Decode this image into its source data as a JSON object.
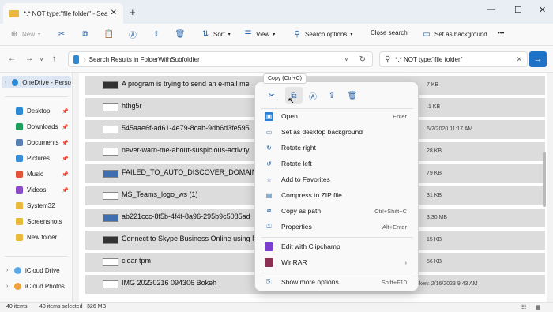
{
  "window": {
    "tab_title": "*.* NOT type:\"file folder\" - Sea",
    "new_tab_symbol": "+",
    "close_tab_symbol": "✕",
    "minimize": "—",
    "maximize": "☐",
    "close": "✕"
  },
  "toolbar": {
    "new_label": "New",
    "sort_label": "Sort",
    "view_label": "View",
    "search_options_label": "Search options",
    "close_search_label": "Close search",
    "set_background_label": "Set as background",
    "more_symbol": "•••"
  },
  "address": {
    "path": "Search Results in FolderWithSubfoldfer",
    "search_query": "*.* NOT type:\"file folder\""
  },
  "sidebar": {
    "onedrive": "OneDrive - Perso",
    "items": [
      {
        "label": "Desktop",
        "color": "#2b8ad6"
      },
      {
        "label": "Downloads",
        "color": "#1e9e5a"
      },
      {
        "label": "Documents",
        "color": "#5a7fb3"
      },
      {
        "label": "Pictures",
        "color": "#3a8ed8"
      },
      {
        "label": "Music",
        "color": "#e0553a"
      },
      {
        "label": "Videos",
        "color": "#8b4bc9"
      },
      {
        "label": "System32",
        "color": "#e8b93a"
      },
      {
        "label": "Screenshots",
        "color": "#e8b93a"
      },
      {
        "label": "New folder",
        "color": "#e8b93a"
      }
    ],
    "icloud_drive": "iCloud Drive",
    "icloud_photos": "iCloud Photos"
  },
  "files": [
    {
      "name": "A program is trying to send an e-mail me",
      "meta": "7 KB"
    },
    {
      "name": "hthg5r",
      "meta": ".1 KB"
    },
    {
      "name": "545aae6f-ad61-4e79-8cab-9db6d3fe595",
      "meta": "6/2/2020 11:17 AM"
    },
    {
      "name": "never-warn-me-about-suspicious-activity",
      "meta": "28 KB"
    },
    {
      "name": "FAILED_TO_AUTO_DISCOVER_DOMAIN er",
      "meta": "79 KB"
    },
    {
      "name": "MS_Teams_logo_ws (1)",
      "meta": "31 KB"
    },
    {
      "name": "ab221ccc-8f5b-4f4f-8a96-295b9c5085ad",
      "meta": "3.30 MB"
    },
    {
      "name": "Connect to Skype Business Online using P",
      "meta": "15 KB"
    },
    {
      "name": "clear tpm",
      "meta": "56 KB"
    },
    {
      "name": "IMG 20230216 094306 Bokeh",
      "meta_type": "Type: jpegfile",
      "meta": "Date taken: 2/16/2023 9:43 AM"
    }
  ],
  "status": {
    "count": "40 items",
    "selected": "40 items selected",
    "size": "326 MB"
  },
  "context_menu": {
    "tooltip": "Copy (Ctrl+C)",
    "items": [
      {
        "label": "Open",
        "shortcut": "Enter"
      },
      {
        "label": "Set as desktop background",
        "shortcut": ""
      },
      {
        "label": "Rotate right",
        "shortcut": ""
      },
      {
        "label": "Rotate left",
        "shortcut": ""
      },
      {
        "label": "Add to Favorites",
        "shortcut": ""
      },
      {
        "label": "Compress to ZIP file",
        "shortcut": ""
      },
      {
        "label": "Copy as path",
        "shortcut": "Ctrl+Shift+C"
      },
      {
        "label": "Properties",
        "shortcut": "Alt+Enter"
      },
      {
        "label": "Edit with Clipchamp",
        "shortcut": ""
      },
      {
        "label": "WinRAR",
        "shortcut": "›"
      },
      {
        "label": "Show more options",
        "shortcut": "Shift+F10"
      }
    ]
  }
}
